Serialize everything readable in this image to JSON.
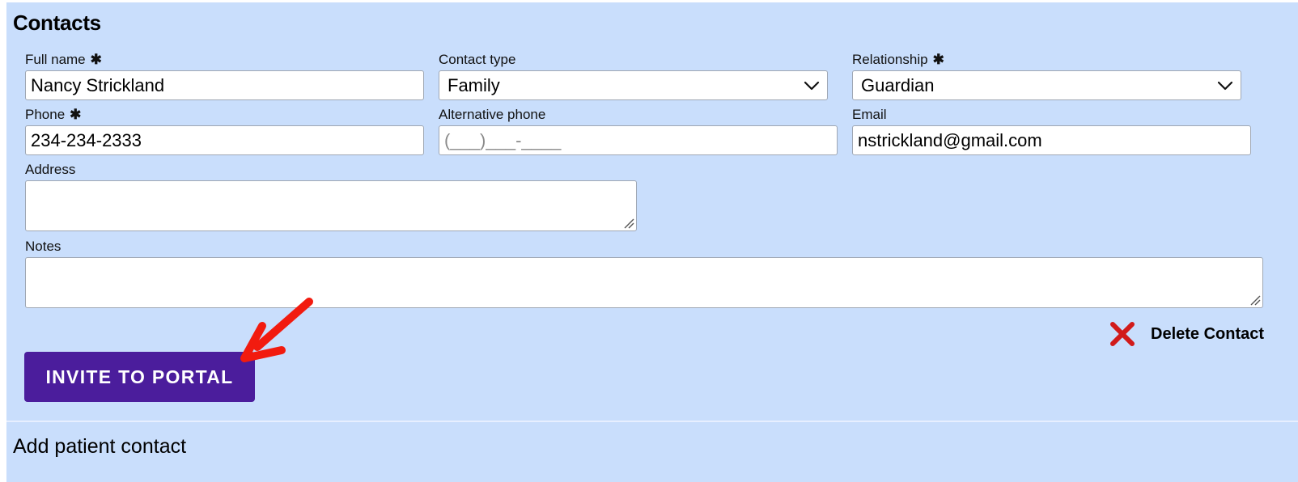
{
  "section": {
    "title": "Contacts"
  },
  "fields": {
    "full_name": {
      "label": "Full name",
      "required_mark": "✱",
      "value": "Nancy Strickland"
    },
    "contact_type": {
      "label": "Contact type",
      "value": "Family"
    },
    "relationship": {
      "label": "Relationship",
      "required_mark": "✱",
      "value": "Guardian"
    },
    "phone": {
      "label": "Phone",
      "required_mark": "✱",
      "value": "234-234-2333"
    },
    "alt_phone": {
      "label": "Alternative phone",
      "placeholder": "(___)___-____"
    },
    "email": {
      "label": "Email",
      "value": "nstrickland@gmail.com"
    },
    "address": {
      "label": "Address"
    },
    "notes": {
      "label": "Notes"
    }
  },
  "actions": {
    "delete_contact": "Delete Contact",
    "invite_to_portal": "INVITE TO PORTAL",
    "add_patient_contact": "Add patient contact"
  },
  "colors": {
    "panel_bg": "#c9defc",
    "button_bg": "#4b1d9c",
    "delete_icon": "#d11a1a",
    "annotation_arrow": "#f21b0f"
  },
  "icons": {
    "select_chevron": "chevron-down-icon",
    "delete": "close-x-icon",
    "annotation": "red-arrow-annotation"
  }
}
